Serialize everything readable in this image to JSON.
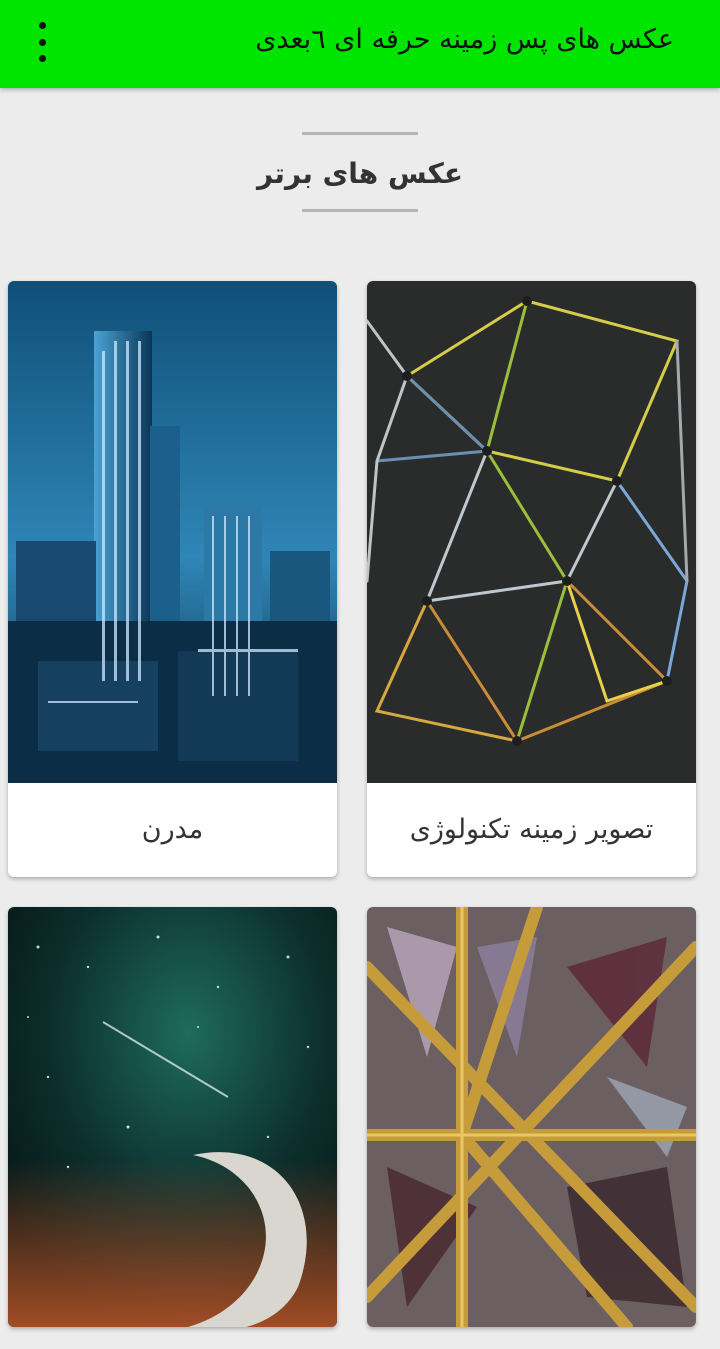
{
  "app_bar": {
    "title": "عکس های پس زمینه حرفه ای ٦بعدی",
    "menu_icon": "more-vertical-icon"
  },
  "section": {
    "heading": "عکس های برتر"
  },
  "cards": [
    {
      "label": "مدرن",
      "image": "night-city-skyline"
    },
    {
      "label": "تصویر زمینه تکنولوژی",
      "image": "glowing-network-lines"
    },
    {
      "label": "",
      "image": "crescent-moon-night-sky"
    },
    {
      "label": "",
      "image": "stained-glass-geometric"
    }
  ],
  "colors": {
    "app_bar": "#00e500",
    "background": "#ececec",
    "card": "#ffffff",
    "text": "#333333"
  }
}
